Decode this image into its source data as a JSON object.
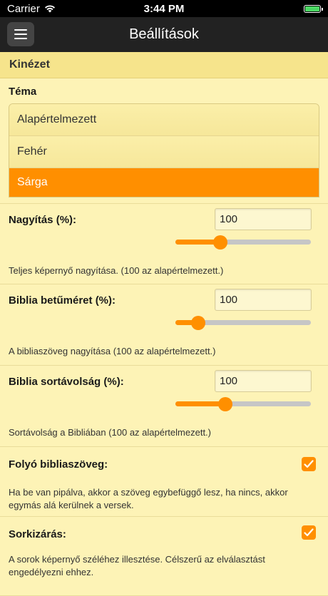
{
  "status": {
    "carrier": "Carrier",
    "time": "3:44 PM",
    "battery_level": 1.0
  },
  "nav": {
    "title": "Beállítások",
    "menu_icon": "hamburger-icon"
  },
  "section": {
    "title": "Kinézet"
  },
  "theme": {
    "label": "Téma",
    "options": [
      "Alapértelmezett",
      "Fehér",
      "Sárga"
    ],
    "selected": "Sárga"
  },
  "zoom": {
    "label": "Nagyítás (%):",
    "value": "100",
    "slider_fraction": 0.33,
    "description": "Teljes képernyő nagyítása. (100 az alapértelmezett.)"
  },
  "font_size": {
    "label": "Biblia betűméret (%):",
    "value": "100",
    "slider_fraction": 0.17,
    "description": "A bibliaszöveg nagyítása (100 az alapértelmezett.)"
  },
  "line_spacing": {
    "label": "Biblia sortávolság (%):",
    "value": "100",
    "slider_fraction": 0.37,
    "description": "Sortávolság a Bibliában (100 az alapértelmezett.)"
  },
  "flowing_text": {
    "label": "Folyó bibliaszöveg:",
    "checked": true,
    "description": "Ha be van pipálva, akkor a szöveg egybefüggő lesz, ha nincs, akkor egymás alá kerülnek a versek."
  },
  "justify": {
    "label": "Sorkizárás:",
    "checked": true,
    "description": "A sorok képernyő széléhez illesztése. Célszerű az elválasztást engedélyezni ehhez."
  },
  "colors": {
    "accent": "#ff8f00",
    "background": "#fdf3b6",
    "header": "#f6e48c",
    "navbar": "#222222"
  }
}
